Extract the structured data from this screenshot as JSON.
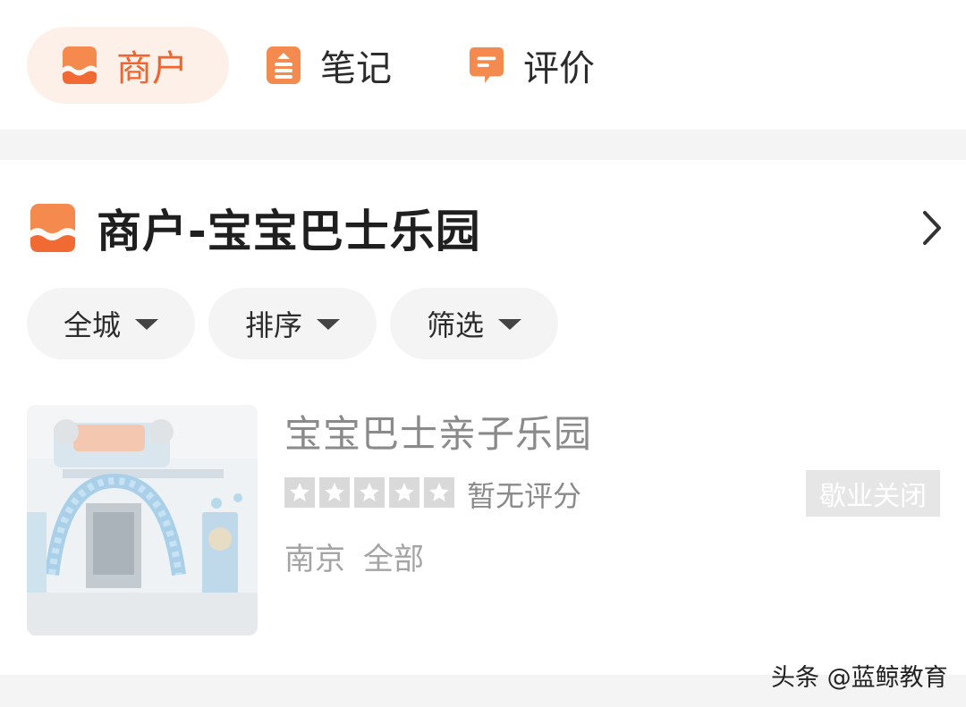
{
  "tabs": [
    {
      "label": "商户",
      "icon": "merchant-icon",
      "active": true
    },
    {
      "label": "笔记",
      "icon": "note-icon",
      "active": false
    },
    {
      "label": "评价",
      "icon": "comment-icon",
      "active": false
    }
  ],
  "section": {
    "title": "商户-宝宝巴士乐园",
    "icon": "merchant-icon",
    "more_icon": "chevron-right-icon"
  },
  "filters": [
    {
      "label": "全城",
      "icon": "caret-down-icon"
    },
    {
      "label": "排序",
      "icon": "caret-down-icon"
    },
    {
      "label": "筛选",
      "icon": "caret-down-icon"
    }
  ],
  "listing": {
    "name": "宝宝巴士亲子乐园",
    "rating_stars": 0,
    "rating_max": 5,
    "rating_text": "暂无评分",
    "status": "歇业关闭",
    "city": "南京",
    "category": "全部"
  },
  "watermark": "头条 @蓝鲸教育",
  "colors": {
    "accent": "#f2642e",
    "active_tab_bg": "#fdf0e8",
    "divider": "#f4f4f4",
    "muted_text": "#8a8a8a"
  }
}
